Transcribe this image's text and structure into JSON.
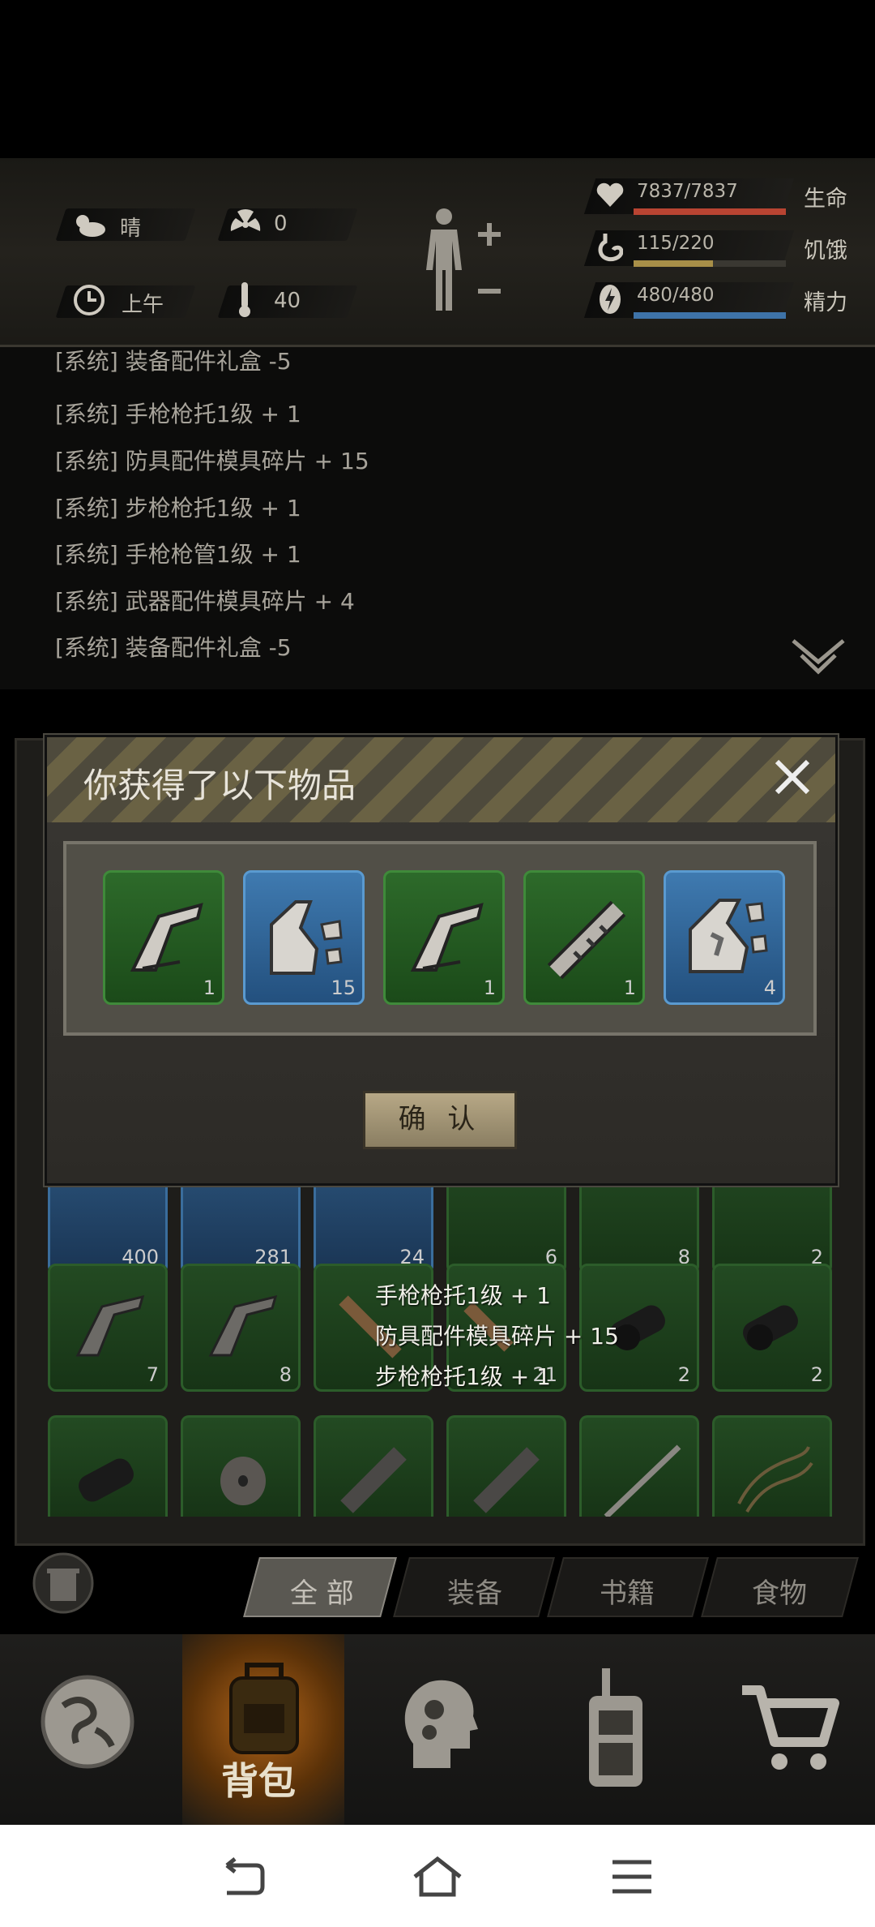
{
  "status": {
    "weather": "晴",
    "radiation": "0",
    "time_of_day": "上午",
    "temperature": "40",
    "health": {
      "value": "7837/7837",
      "label": "生命",
      "fraction": 1.0,
      "color": "#b84432"
    },
    "hunger": {
      "value": "115/220",
      "label": "饥饿",
      "fraction": 0.52,
      "color": "#a88f48"
    },
    "energy": {
      "value": "480/480",
      "label": "精力",
      "fraction": 1.0,
      "color": "#3e73a8"
    }
  },
  "log": {
    "lines": [
      "[系统] 装备配件礼盒 -5",
      "[系统] 手枪枪托1级 + 1",
      "[系统] 防具配件模具碎片 + 15",
      "[系统] 步枪枪托1级 + 1",
      "[系统] 手枪枪管1级 + 1",
      "[系统] 武器配件模具碎片 + 4",
      "[系统] 装备配件礼盒 -5"
    ]
  },
  "modal": {
    "title": "你获得了以下物品",
    "items": [
      {
        "icon": "stock-icon",
        "count": "1",
        "rarity": "green"
      },
      {
        "icon": "armor-fragment-icon",
        "count": "15",
        "rarity": "blue"
      },
      {
        "icon": "stock-icon",
        "count": "1",
        "rarity": "green"
      },
      {
        "icon": "barrel-icon",
        "count": "1",
        "rarity": "green"
      },
      {
        "icon": "weapon-fragment-icon",
        "count": "4",
        "rarity": "blue"
      }
    ],
    "confirm_label": "确 认"
  },
  "inventory": {
    "row1": [
      "400",
      "281",
      "24",
      "6",
      "8",
      "2"
    ],
    "row2": [
      "7",
      "8",
      "",
      "21",
      "2",
      "2"
    ],
    "row3": [
      "",
      "",
      "",
      "",
      "",
      ""
    ]
  },
  "toast": [
    "手枪枪托1级 + 1",
    "防具配件模具碎片 + 15",
    "步枪枪托1级 + 1"
  ],
  "tabs": [
    "全 部",
    "装备",
    "书籍",
    "食物"
  ],
  "nav": {
    "backpack_label": "背包"
  },
  "colors": {
    "accent": "#e07a1a"
  }
}
